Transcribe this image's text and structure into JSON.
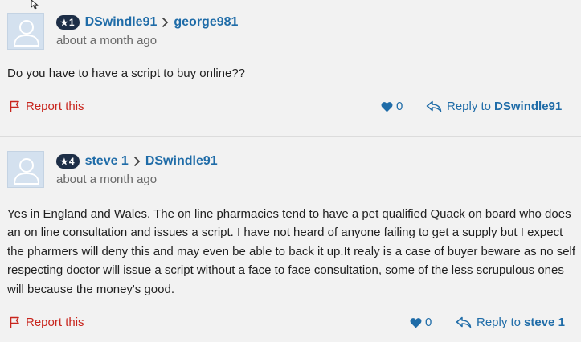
{
  "posts": [
    {
      "badge": "1",
      "author": "DSwindle91",
      "reply_to": "george981",
      "time": "about a month ago",
      "body": "Do you have to have a script to buy online??",
      "report_label": "Report this",
      "likes": "0",
      "reply_label": "Reply to",
      "reply_user": "DSwindle91"
    },
    {
      "badge": "4",
      "author": "steve 1",
      "reply_to": "DSwindle91",
      "time": "about a month ago",
      "body": "Yes in England and Wales. The on line pharmacies tend to have a pet qualified Quack on board who does an on line consultation and issues a script. I have not heard of anyone failing to get a supply but I expect the pharmers will deny this and may even be able to back it up.It realy is a case of buyer beware as no self respecting doctor will issue a script without a face to face consultation, some of the less scrupulous ones will because the money's good.",
      "report_label": "Report this",
      "likes": "0",
      "reply_label": "Reply to",
      "reply_user": "steve 1"
    }
  ],
  "colors": {
    "link": "#1f6ca8",
    "report": "#c8251d",
    "badge_bg": "#1d2e47",
    "background": "#f2f2f2"
  },
  "icons": {
    "badge": "star-icon",
    "separator": "chevron-right-icon",
    "report": "flag-icon",
    "like": "heart-icon",
    "reply": "reply-arrow-icon",
    "avatar": "default-user-avatar"
  }
}
